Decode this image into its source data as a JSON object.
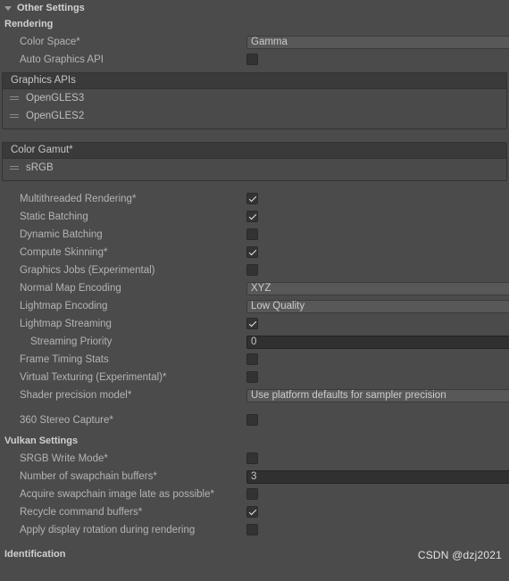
{
  "header": {
    "title": "Other Settings",
    "expanded_icon": "triangle-down-icon"
  },
  "sections": {
    "rendering": {
      "label": "Rendering",
      "color_space": {
        "label": "Color Space*",
        "value": "Gamma"
      },
      "auto_graphics_api": {
        "label": "Auto Graphics API",
        "checked": false
      },
      "graphics_apis": {
        "title": "Graphics APIs",
        "items": [
          {
            "label": "OpenGLES3"
          },
          {
            "label": "OpenGLES2"
          }
        ]
      },
      "color_gamut": {
        "title": "Color Gamut*",
        "items": [
          {
            "label": "sRGB"
          }
        ]
      },
      "toggles": [
        {
          "label": "Multithreaded Rendering*",
          "checked": true
        },
        {
          "label": "Static Batching",
          "checked": true
        },
        {
          "label": "Dynamic Batching",
          "checked": false
        },
        {
          "label": "Compute Skinning*",
          "checked": true
        },
        {
          "label": "Graphics Jobs (Experimental)",
          "checked": false
        }
      ],
      "normal_map_encoding": {
        "label": "Normal Map Encoding",
        "value": "XYZ"
      },
      "lightmap_encoding": {
        "label": "Lightmap Encoding",
        "value": "Low Quality"
      },
      "lightmap_streaming": {
        "label": "Lightmap Streaming",
        "checked": true
      },
      "streaming_priority": {
        "label": "Streaming Priority",
        "value": "0"
      },
      "frame_timing_stats": {
        "label": "Frame Timing Stats",
        "checked": false
      },
      "virtual_texturing": {
        "label": "Virtual Texturing (Experimental)*",
        "checked": false
      },
      "shader_precision_model": {
        "label": "Shader precision model*",
        "value": "Use platform defaults for sampler precision"
      },
      "stereo_capture_360": {
        "label": "360 Stereo Capture*",
        "checked": false
      }
    },
    "vulkan": {
      "label": "Vulkan Settings",
      "srgb_write_mode": {
        "label": "SRGB Write Mode*",
        "checked": false
      },
      "swapchain_buffers": {
        "label": "Number of swapchain buffers*",
        "value": "3"
      },
      "acquire_late": {
        "label": "Acquire swapchain image late as possible*",
        "checked": false
      },
      "recycle_command_buffers": {
        "label": "Recycle command buffers*",
        "checked": true
      },
      "apply_display_rotation": {
        "label": "Apply display rotation during rendering",
        "checked": false
      }
    },
    "identification": {
      "label": "Identification"
    }
  },
  "watermark": {
    "text": "CSDN @dzj2021"
  }
}
